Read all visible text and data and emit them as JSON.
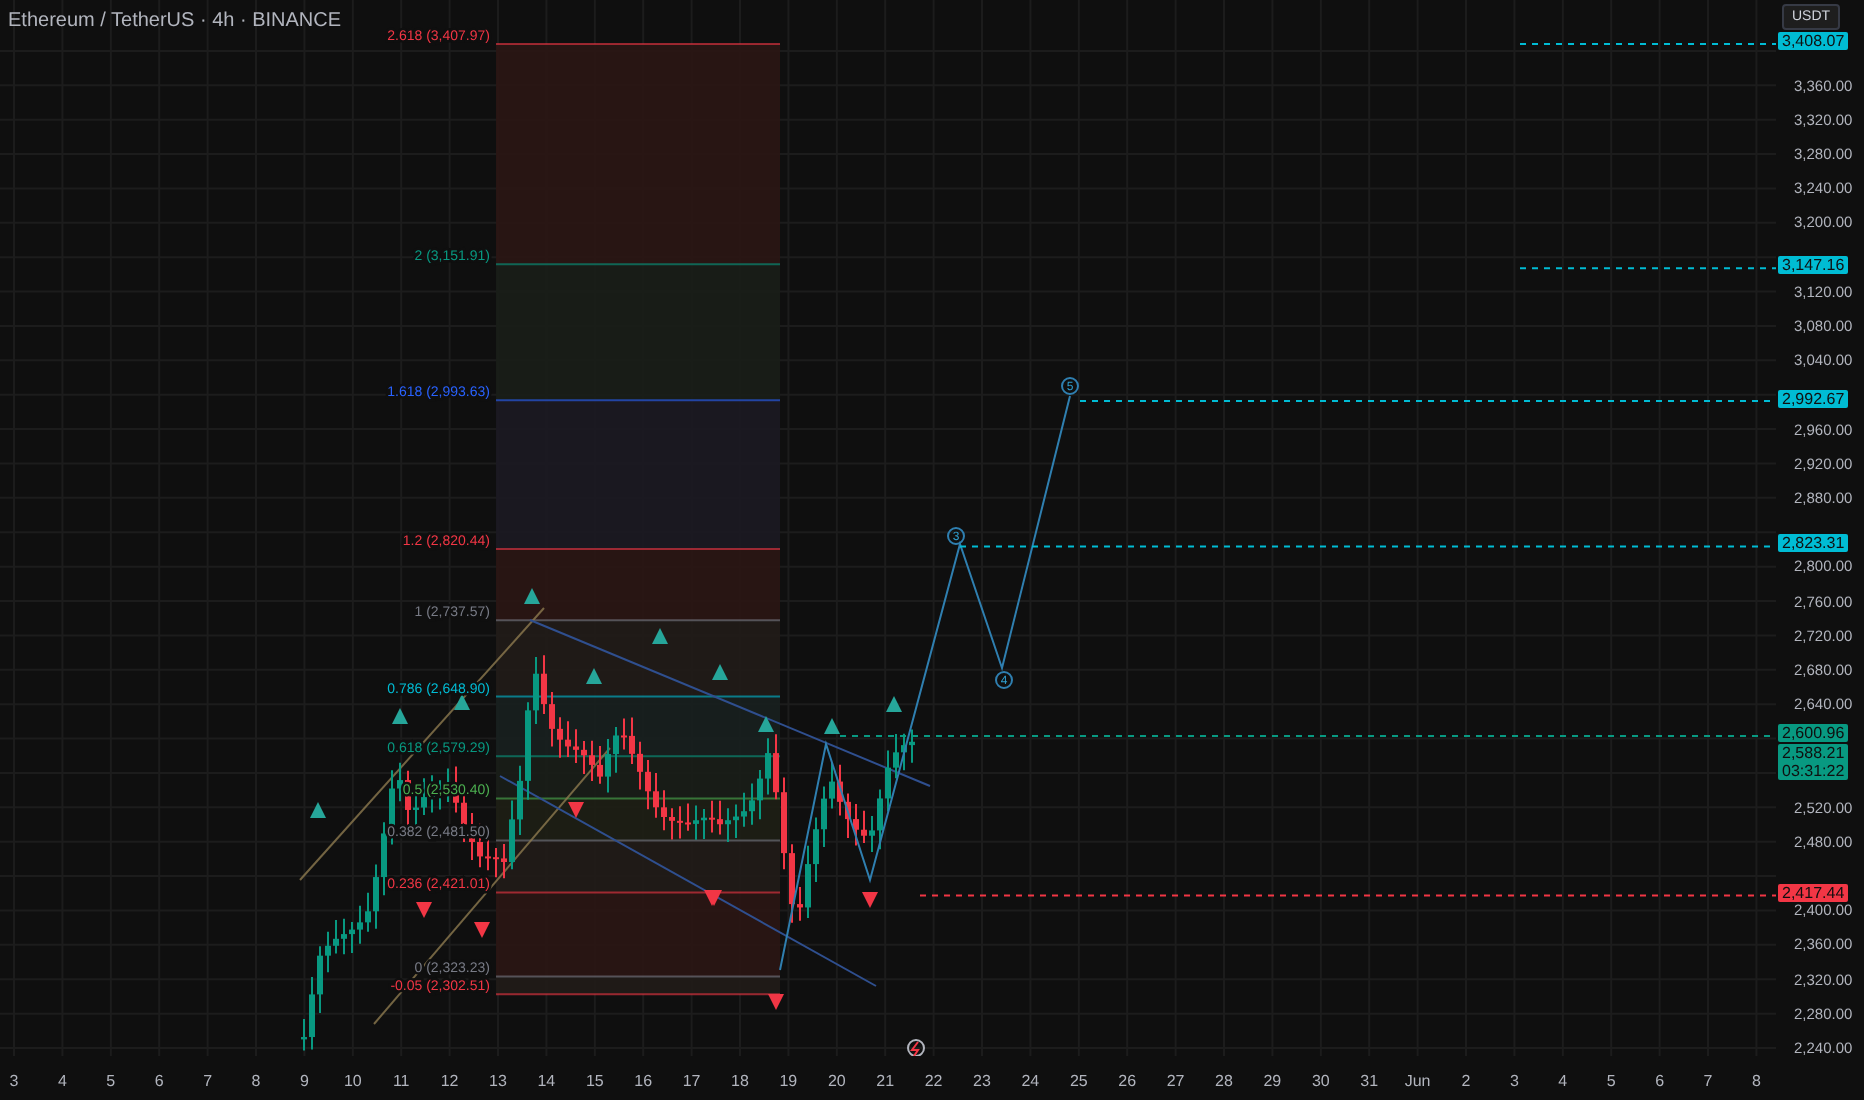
{
  "header": {
    "title": "Ethereum / TetherUS · 4h · BINANCE"
  },
  "currency_button": {
    "label": "USDT"
  },
  "fib_levels": [
    {
      "label": "2.618 (3,407.97)",
      "color": "#f23645"
    },
    {
      "label": "2 (3,151.91)",
      "color": "#089981"
    },
    {
      "label": "1.618 (2,993.63)",
      "color": "#2962ff"
    },
    {
      "label": "1.2 (2,820.44)",
      "color": "#f23645"
    },
    {
      "label": "1 (2,737.57)",
      "color": "#787b86"
    },
    {
      "label": "0.786 (2,648.90)",
      "color": "#00bcd4"
    },
    {
      "label": "0.618 (2,579.29)",
      "color": "#089981"
    },
    {
      "label": "0.5 (2,530.40)",
      "color": "#4caf50"
    },
    {
      "label": "0.382 (2,481.50)",
      "color": "#787b86"
    },
    {
      "label": "0.236 (2,421.01)",
      "color": "#f23645"
    },
    {
      "label": "0 (2,323.23)",
      "color": "#787b86"
    },
    {
      "label": "-0.05 (2,302.51)",
      "color": "#f23645"
    }
  ],
  "wave_labels": [
    "3",
    "4",
    "5"
  ],
  "price_axis": [
    "3,360.00",
    "3,320.00",
    "3,280.00",
    "3,240.00",
    "3,200.00",
    "3,120.00",
    "3,080.00",
    "3,040.00",
    "2,960.00",
    "2,920.00",
    "2,880.00",
    "2,800.00",
    "2,760.00",
    "2,720.00",
    "2,680.00",
    "2,640.00",
    "2,520.00",
    "2,480.00",
    "2,400.00",
    "2,360.00",
    "2,320.00",
    "2,280.00",
    "2,240.00"
  ],
  "price_tags": [
    {
      "value": "3,408.07",
      "color": "#00bcd4"
    },
    {
      "value": "3,147.16",
      "color": "#00bcd4"
    },
    {
      "value": "2,992.67",
      "color": "#00bcd4"
    },
    {
      "value": "2,823.31",
      "color": "#00bcd4"
    },
    {
      "value": "2,600.96",
      "color": "#089981"
    },
    {
      "value": "2,588.21",
      "countdown": "03:31:22",
      "color": "#089981"
    },
    {
      "value": "2,417.44",
      "color": "#f23645"
    }
  ],
  "date_axis": [
    "3",
    "4",
    "5",
    "6",
    "7",
    "8",
    "9",
    "10",
    "11",
    "12",
    "13",
    "14",
    "15",
    "16",
    "17",
    "18",
    "19",
    "20",
    "21",
    "22",
    "23",
    "24",
    "25",
    "26",
    "27",
    "28",
    "29",
    "30",
    "31",
    "Jun",
    "2",
    "3",
    "4",
    "5",
    "6",
    "7",
    "8"
  ]
}
